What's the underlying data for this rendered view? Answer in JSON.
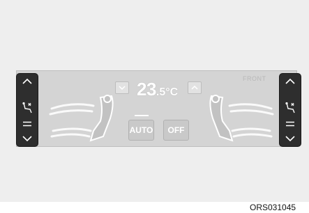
{
  "panel": {
    "temperature": {
      "integer": "23",
      "decimal": ".5",
      "unit": "°C"
    },
    "zone_label": "FRONT",
    "auto_label": "AUTO",
    "off_label": "OFF"
  },
  "left_knob": {
    "icons": [
      "chevron-up-icon",
      "seat-heat-icon",
      "menu-icon",
      "chevron-down-icon"
    ]
  },
  "right_knob": {
    "icons": [
      "chevron-up-icon",
      "seat-heat-icon",
      "menu-icon",
      "chevron-down-icon"
    ]
  },
  "figure_code": "ORS031045",
  "colors": {
    "panel": "#d4d4d4",
    "knob": "#2e2e2e",
    "display_text": "#ffffff"
  }
}
